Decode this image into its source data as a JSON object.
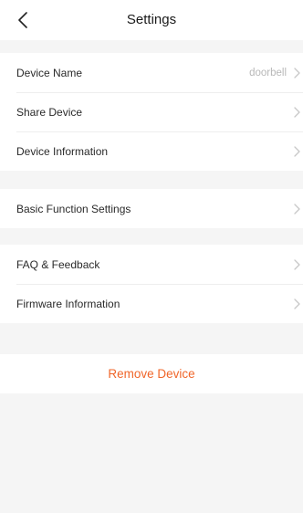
{
  "header": {
    "title": "Settings",
    "back_icon": "chevron-left-icon"
  },
  "groups": [
    {
      "rows": [
        {
          "label": "Device Name",
          "value": "doorbell"
        },
        {
          "label": "Share Device"
        },
        {
          "label": "Device Information"
        }
      ]
    },
    {
      "rows": [
        {
          "label": "Basic Function Settings"
        }
      ]
    },
    {
      "rows": [
        {
          "label": "FAQ & Feedback"
        },
        {
          "label": "Firmware Information"
        }
      ]
    }
  ],
  "actions": {
    "remove_label": "Remove Device"
  },
  "colors": {
    "accent": "#f0662a",
    "background": "#f5f5f5",
    "chevron": "#c8c8c8"
  }
}
